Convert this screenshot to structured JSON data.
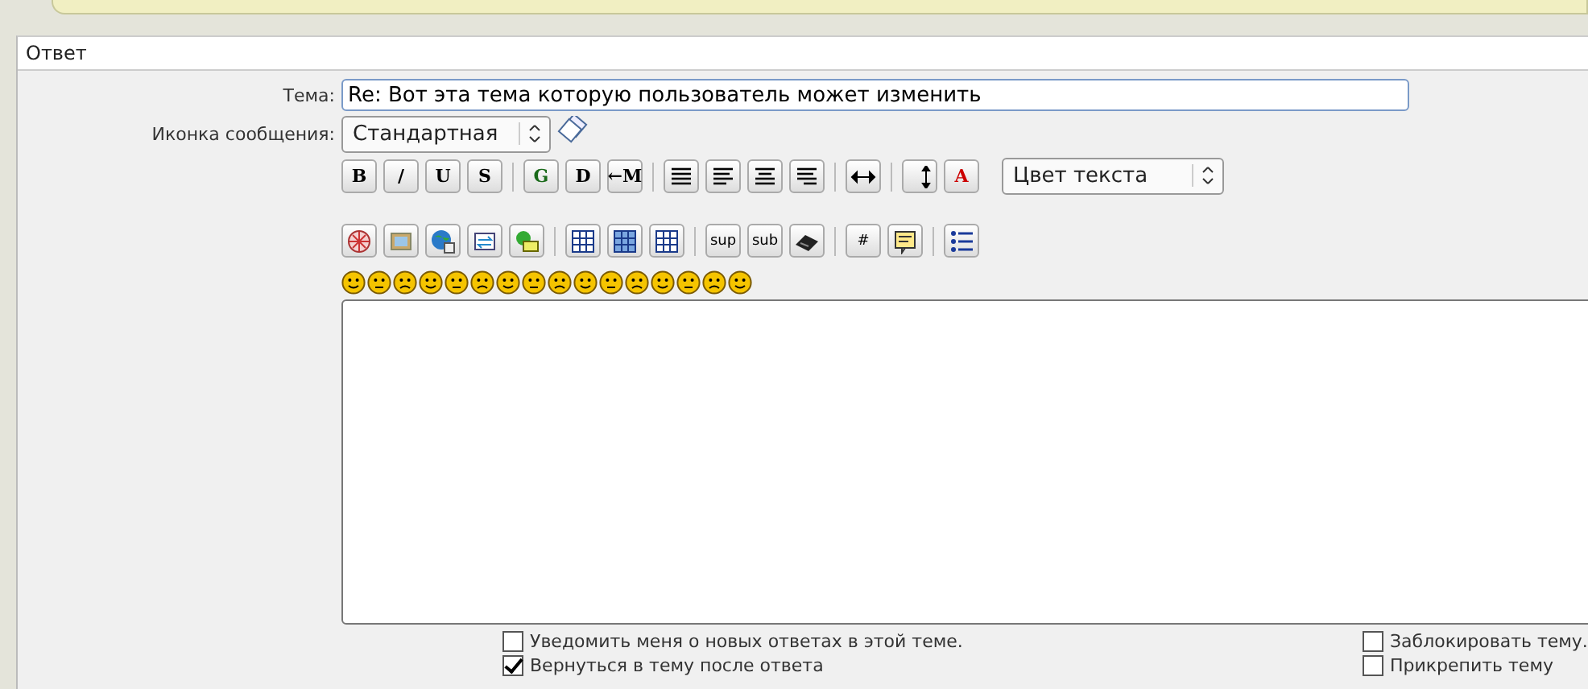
{
  "panel": {
    "title": "Ответ"
  },
  "subject": {
    "label": "Тема:",
    "value": "Re: Вот эта тема которую пользователь может изменить"
  },
  "icon_field": {
    "label": "Иконка сообщения:",
    "value": "Стандартная"
  },
  "toolbar_row_1": [
    {
      "kind": "glyph",
      "label": "B"
    },
    {
      "kind": "glyph",
      "label": "/"
    },
    {
      "kind": "glyph",
      "label": "U"
    },
    {
      "kind": "glyph",
      "label": "S"
    },
    {
      "kind": "separator"
    },
    {
      "kind": "glyph",
      "label": "G"
    },
    {
      "kind": "glyph",
      "label": "D"
    },
    {
      "kind": "glyph",
      "label": "←M"
    },
    {
      "kind": "separator"
    },
    {
      "kind": "icon"
    },
    {
      "kind": "icon"
    },
    {
      "kind": "icon"
    },
    {
      "kind": "icon"
    },
    {
      "kind": "separator"
    },
    {
      "kind": "icon"
    },
    {
      "kind": "separator"
    },
    {
      "kind": "icon"
    },
    {
      "kind": "glyph",
      "label": "A"
    }
  ],
  "color_select": {
    "value": "Цвет текста"
  },
  "toolbar_row_2": [
    {
      "kind": "icon"
    },
    {
      "kind": "icon"
    },
    {
      "kind": "icon"
    },
    {
      "kind": "icon"
    },
    {
      "kind": "icon"
    },
    {
      "kind": "separator"
    },
    {
      "kind": "icon"
    },
    {
      "kind": "icon"
    },
    {
      "kind": "icon"
    },
    {
      "kind": "separator"
    },
    {
      "kind": "glyph",
      "label": "sup"
    },
    {
      "kind": "glyph",
      "label": "sub"
    },
    {
      "kind": "icon"
    },
    {
      "kind": "separator"
    },
    {
      "kind": "glyph",
      "label": "#"
    },
    {
      "kind": "icon"
    },
    {
      "kind": "separator"
    },
    {
      "kind": "icon"
    }
  ],
  "options_left": [
    {
      "label": "Уведомить меня о новых ответах в этой теме.",
      "checked": false
    },
    {
      "label": "Вернуться в тему после ответа",
      "checked": true
    }
  ],
  "options_right": [
    {
      "label": "Заблокировать тему.",
      "checked": false
    },
    {
      "label": "Прикрепить тему",
      "checked": false
    }
  ]
}
